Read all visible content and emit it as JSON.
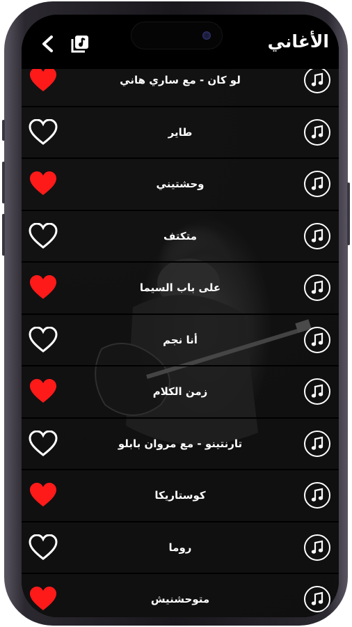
{
  "header": {
    "title": "الأغاني"
  },
  "songs": [
    {
      "name": "لو كان - مع ساري هاني",
      "favorite": true
    },
    {
      "name": "طاير",
      "favorite": false
    },
    {
      "name": "وحشتيني",
      "favorite": true
    },
    {
      "name": "متكتف",
      "favorite": false
    },
    {
      "name": "على باب السيما",
      "favorite": true
    },
    {
      "name": "أنا نجم",
      "favorite": false
    },
    {
      "name": "زمن الكلام",
      "favorite": true
    },
    {
      "name": "تارنتينو - مع مروان بابلو",
      "favorite": false
    },
    {
      "name": "كوستاريكا",
      "favorite": true
    },
    {
      "name": "روما",
      "favorite": false
    },
    {
      "name": "متوحشنيش",
      "favorite": true
    }
  ],
  "colors": {
    "heart_filled": "#ff1a1a",
    "heart_outline": "#ffffff",
    "text": "#ffffff",
    "background": "#000000"
  },
  "icons": {
    "back": "chevron-left-icon",
    "playlist": "playlist-icon",
    "song": "music-note-icon",
    "favorite": "heart-icon"
  }
}
